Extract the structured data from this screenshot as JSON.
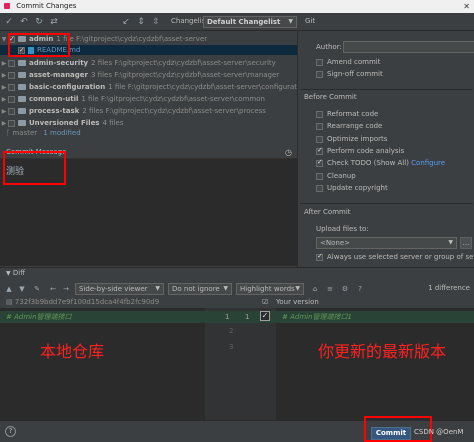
{
  "window": {
    "title": "Commit Changes",
    "close_glyph": "✕"
  },
  "toolbar": {
    "changelist_label": "Changelist:",
    "changelist_value": "Default Changelist",
    "git_label": "Git",
    "icons": [
      "check-icon",
      "undo-icon",
      "refresh-icon",
      "diff-icon",
      "arrow-icon",
      "expand-icon",
      "collapse-icon"
    ]
  },
  "tree": [
    {
      "name": "admin",
      "meta": "1 file F:\\gitproject\\cydz\\cydzbf\\asset-server",
      "expanded": true,
      "checked": true
    },
    {
      "name": "README.md",
      "file": true,
      "checked": true
    },
    {
      "name": "admin-security",
      "meta": "2 files F:\\gitproject\\cydz\\cydzbf\\asset-server\\security"
    },
    {
      "name": "asset-manager",
      "meta": "3 files F:\\gitproject\\cydz\\cydzbf\\asset-server\\manager"
    },
    {
      "name": "basic-configuration",
      "meta": "1 file F:\\gitproject\\cydz\\cydzbf\\asset-server\\configuration"
    },
    {
      "name": "common-util",
      "meta": "1 file F:\\gitproject\\cydz\\cydzbf\\asset-server\\common"
    },
    {
      "name": "process-task",
      "meta": "2 files F:\\gitproject\\cydz\\cydzbf\\asset-server\\process"
    },
    {
      "name": "Unversioned Files",
      "meta": "4 files"
    }
  ],
  "status": {
    "branch": "master",
    "modified": "1 modified"
  },
  "commit_message": {
    "header": "Commit Message",
    "text": "测验"
  },
  "right": {
    "author_label": "Author:",
    "amend_commit": "Amend commit",
    "sign_off": "Sign-off commit",
    "before_commit": "Before Commit",
    "options": [
      {
        "label": "Reformat code",
        "checked": false
      },
      {
        "label": "Rearrange code",
        "checked": false
      },
      {
        "label": "Optimize imports",
        "checked": false
      },
      {
        "label": "Perform code analysis",
        "checked": true
      },
      {
        "label": "Check TODO (Show All)",
        "checked": true,
        "link": "Configure"
      },
      {
        "label": "Cleanup",
        "checked": false
      },
      {
        "label": "Update copyright",
        "checked": false
      }
    ],
    "after_commit": "After Commit",
    "upload_label": "Upload files to:",
    "upload_value": "<None>",
    "ellipsis": "...",
    "always_use": "Always use selected server or group of servers"
  },
  "diff": {
    "header": "Diff",
    "viewer": "Side-by-side viewer",
    "ignore": "Do not ignore",
    "highlight": "Highlight words",
    "count": "1 difference",
    "left_path": "732f3b9bdd7e9f100d15dca4f4fb2fc90d9",
    "right_path": "Your version",
    "left_line": "# Admin管理端接口",
    "right_line": "# Admin管理端接口1",
    "left_nums": [
      "1"
    ],
    "right_nums": [
      "1",
      "2",
      "3"
    ],
    "annot_left": "本地仓库",
    "annot_right": "你更新的最新版本"
  },
  "bottom": {
    "help": "?",
    "commit": "Commit",
    "watermark": "CSDN @OenM"
  }
}
